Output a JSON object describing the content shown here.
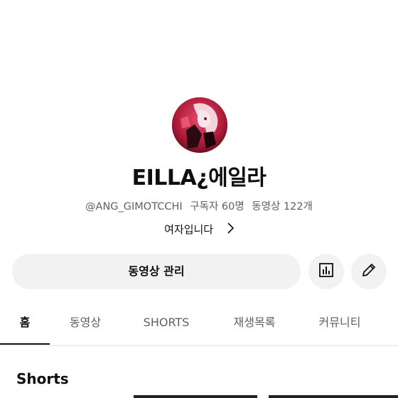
{
  "channel": {
    "name": "EILLA¿에일라",
    "handle": "@ANG_GIMOTCCHI",
    "subscribers": "구독자 60명",
    "videos": "동영상 122개",
    "description": "여자입니다"
  },
  "actions": {
    "manage_label": "동영상 관리",
    "stats_icon": "bar-chart-icon",
    "edit_icon": "pencil-icon"
  },
  "tabs": [
    {
      "label": "홈",
      "active": true
    },
    {
      "label": "동영상",
      "active": false
    },
    {
      "label": "SHORTS",
      "active": false
    },
    {
      "label": "재생목록",
      "active": false
    },
    {
      "label": "커뮤니티",
      "active": false
    }
  ],
  "sections": {
    "shorts_title": "Shorts"
  },
  "colors": {
    "background": "#ffffff",
    "text_primary": "#0f0f0f",
    "text_secondary": "#606060",
    "button_bg": "#f2f2f2"
  }
}
